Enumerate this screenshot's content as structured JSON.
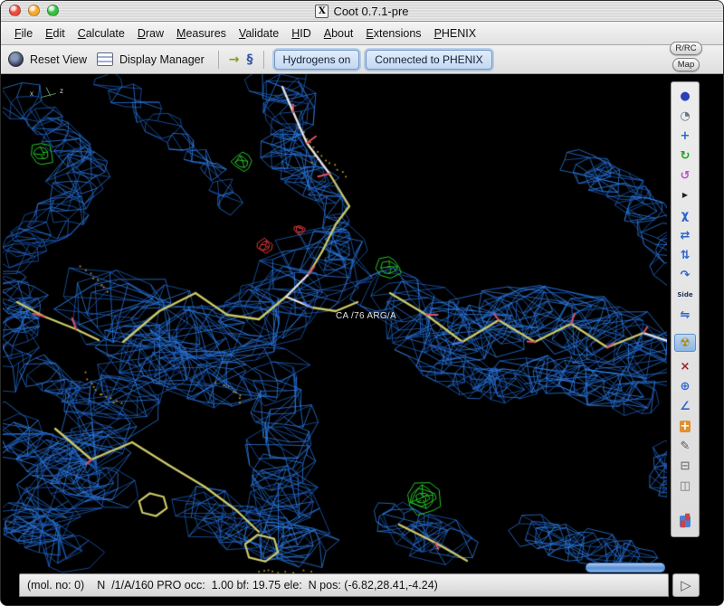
{
  "window": {
    "title": "Coot 0.7.1-pre",
    "icon_glyph": "X"
  },
  "menubar": {
    "items": [
      {
        "name": "menu-file",
        "label": "File"
      },
      {
        "name": "menu-edit",
        "label": "Edit"
      },
      {
        "name": "menu-calculate",
        "label": "Calculate"
      },
      {
        "name": "menu-draw",
        "label": "Draw"
      },
      {
        "name": "menu-measures",
        "label": "Measures"
      },
      {
        "name": "menu-validate",
        "label": "Validate"
      },
      {
        "name": "menu-hid",
        "label": "HID"
      },
      {
        "name": "menu-about",
        "label": "About"
      },
      {
        "name": "menu-extensions",
        "label": "Extensions"
      },
      {
        "name": "menu-phenix",
        "label": "PHENIX"
      }
    ]
  },
  "toolbar": {
    "reset_view": "Reset View",
    "display_manager": "Display Manager",
    "icons": [
      {
        "name": "go-to-atom-icon",
        "glyph": "→",
        "color": "#8a9a1a"
      },
      {
        "name": "sequence-view-icon",
        "glyph": "§",
        "color": "#3355aa"
      }
    ],
    "hydrogens_button": "Hydrogens on",
    "phenix_button": "Connected to PHENIX"
  },
  "right_buttons": {
    "rrc": "R/RC",
    "map": "Map"
  },
  "sidebar": {
    "items": [
      {
        "name": "sphere-icon",
        "glyph": "●",
        "color": "#2a3fb8"
      },
      {
        "name": "globe-icon",
        "glyph": "◔",
        "color": "#667788"
      },
      {
        "name": "move-atoms-icon",
        "glyph": "+",
        "color": "#2b66cc"
      },
      {
        "name": "real-space-refine-icon",
        "glyph": "↻",
        "color": "#1fa01f"
      },
      {
        "name": "rotate-translate-icon",
        "glyph": "↺",
        "color": "#c050c8"
      },
      {
        "name": "expander-icon",
        "glyph": "▶",
        "color": "#222222",
        "size": "8px"
      },
      {
        "name": "chi-angles-icon",
        "glyph": "χ",
        "color": "#2b66cc"
      },
      {
        "name": "flip-peptide-icon",
        "glyph": "⇄",
        "color": "#2b66cc"
      },
      {
        "name": "torsion-icon",
        "glyph": "⇅",
        "color": "#2b66cc"
      },
      {
        "name": "rotamer-icon",
        "glyph": "↷",
        "color": "#2b66cc"
      },
      {
        "name": "side-chain-icon",
        "glyph": "Side",
        "color": "#223355",
        "size": "7px"
      },
      {
        "name": "backbone-icon",
        "glyph": "⇋",
        "color": "#2b66cc"
      },
      {
        "name": "radiation-icon",
        "glyph": "☢",
        "color": "#b08a00",
        "selected": true,
        "gap": 10
      },
      {
        "name": "mutate-icon",
        "glyph": "×",
        "color": "#992222",
        "gap": 5
      },
      {
        "name": "find-waters-icon",
        "glyph": "⊕",
        "color": "#2b66cc"
      },
      {
        "name": "measure-icon",
        "glyph": "∠",
        "color": "#2b66cc"
      },
      {
        "name": "add-terminal-residue-icon",
        "glyph": "+",
        "color": "#ffffff",
        "bg": "#e09030"
      },
      {
        "name": "pencil-icon",
        "glyph": "✎",
        "color": "#555555"
      },
      {
        "name": "delete-icon",
        "glyph": "⊟",
        "color": "#777777"
      },
      {
        "name": "eraser-icon",
        "glyph": "◫",
        "color": "#777777"
      },
      {
        "name": "screenshot-icon",
        "glyph": "▞",
        "color": "#cc4444",
        "bg": "#4a7fd8",
        "gap": 18
      }
    ]
  },
  "viewport": {
    "residue_label": "CA /76 ARG/A",
    "axes": {
      "x": "x",
      "z": "z"
    },
    "colors": {
      "background": "#000000",
      "density": "#2e7fe8",
      "density_dim": "#1d5fc0",
      "positive": "#27c427",
      "negative": "#e03a3a",
      "sticks": "#cdc96a",
      "sticks_light": "#e4e4e4",
      "oxygen": "#e0506a",
      "nitrogen": "#5577ee",
      "dots": "#b8922a"
    }
  },
  "status_bar": {
    "mol": "(mol. no: 0)",
    "atom": "N  /1/A/160 PRO occ:  1.00 bf: 19.75 ele:  N pos: (-6.82,28.41,-4.24)"
  },
  "bottom": {
    "expander_icon": "▷"
  }
}
